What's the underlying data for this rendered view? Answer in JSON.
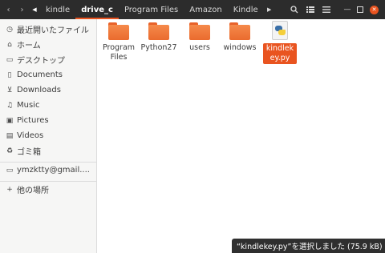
{
  "header": {
    "breadcrumbs": [
      {
        "label": "kindle",
        "active": false
      },
      {
        "label": "drive_c",
        "active": true
      },
      {
        "label": "Program Files",
        "active": false
      },
      {
        "label": "Amazon",
        "active": false
      },
      {
        "label": "Kindle",
        "active": false
      }
    ],
    "icons": [
      "chevron-left-icon",
      "chevron-right-icon",
      "search-icon",
      "list-view-icon",
      "menu-icon",
      "minimize-icon",
      "maximize-icon",
      "close-icon"
    ],
    "accent_color": "#e95420"
  },
  "sidebar": {
    "items": [
      {
        "label": "最近開いたファイル",
        "icon": "clock-icon"
      },
      {
        "label": "ホーム",
        "icon": "home-icon"
      },
      {
        "label": "デスクトップ",
        "icon": "desktop-icon"
      },
      {
        "label": "Documents",
        "icon": "document-icon"
      },
      {
        "label": "Downloads",
        "icon": "download-icon"
      },
      {
        "label": "Music",
        "icon": "music-icon"
      },
      {
        "label": "Pictures",
        "icon": "picture-icon"
      },
      {
        "label": "Videos",
        "icon": "video-icon"
      },
      {
        "label": "ゴミ箱",
        "icon": "trash-icon"
      },
      {
        "label": "ymzktty@gmail....",
        "icon": "drive-icon"
      },
      {
        "label": "他の場所",
        "icon": "plus-icon"
      }
    ]
  },
  "files": [
    {
      "label": "Program Files",
      "type": "folder"
    },
    {
      "label": "Python27",
      "type": "folder"
    },
    {
      "label": "users",
      "type": "folder"
    },
    {
      "label": "windows",
      "type": "folder"
    },
    {
      "label": "kindlekey.py",
      "type": "python",
      "selected": true
    }
  ],
  "status": {
    "text": "“kindlekey.py”を選択しました (75.9 kB)"
  }
}
